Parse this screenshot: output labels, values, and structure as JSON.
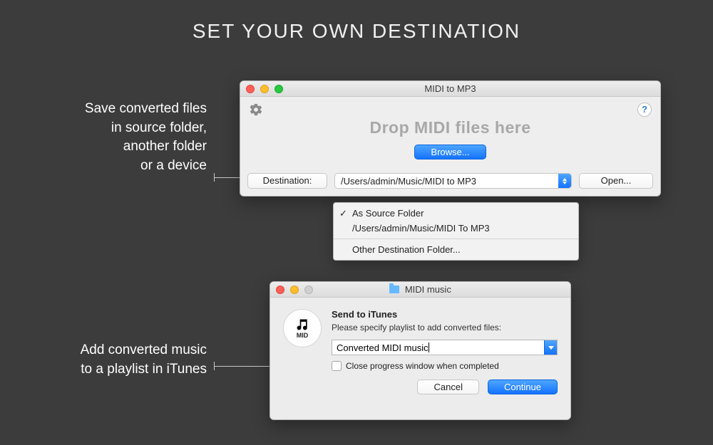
{
  "mainTitle": "SET YOUR OWN DESTINATION",
  "caption1": {
    "line1": "Save converted files",
    "line2": "in source folder,",
    "line3": "another folder",
    "line4": "or a device"
  },
  "caption2": {
    "line1": "Add converted music",
    "line2": "to a playlist in iTunes"
  },
  "win1": {
    "title": "MIDI to MP3",
    "dropTitle": "Drop MIDI files here",
    "browse": "Browse...",
    "destLabel": "Destination:",
    "destPath": "/Users/admin/Music/MIDI to MP3",
    "open": "Open..."
  },
  "dropdown": {
    "item1": "As Source Folder",
    "item2": "/Users/admin/Music/MIDI To MP3",
    "item3": "Other Destination Folder..."
  },
  "win2": {
    "title": "MIDI music",
    "iconLabel": "MID",
    "sheetTitle": "Send to iTunes",
    "sheetSub": "Please specify playlist to add converted files:",
    "playlist": "Converted MIDI music",
    "checkboxLabel": "Close progress window when completed",
    "cancel": "Cancel",
    "continue": "Continue"
  }
}
